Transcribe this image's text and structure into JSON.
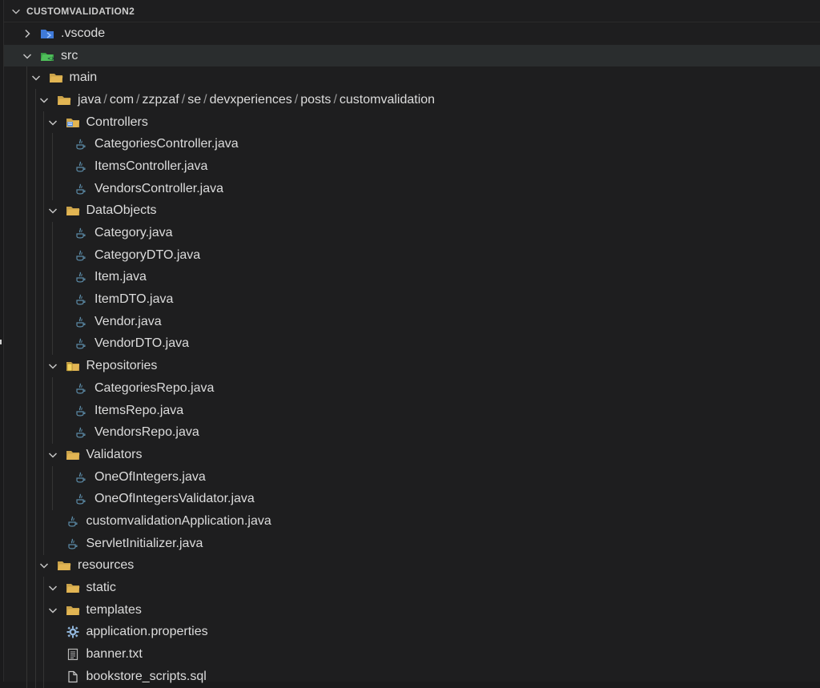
{
  "explorer": {
    "title": "CUSTOMVALIDATION2",
    "items": [
      {
        "label": ".vscode",
        "level": 1,
        "expanded": false,
        "icon": "vscode-folder-icon",
        "kind": "folder"
      },
      {
        "label": "src",
        "level": 1,
        "expanded": true,
        "icon": "src-folder-icon",
        "kind": "folder"
      },
      {
        "label": "main",
        "level": 2,
        "expanded": true,
        "icon": "folder-open-icon",
        "kind": "folder"
      },
      {
        "label": "java/com/zzpzaf/se/devxperiences/posts/customvalidation",
        "level": 3,
        "expanded": true,
        "icon": "folder-open-icon",
        "kind": "folder"
      },
      {
        "label": "Controllers",
        "level": 4,
        "expanded": true,
        "icon": "controllers-folder-icon",
        "kind": "folder"
      },
      {
        "label": "CategoriesController.java",
        "level": 5,
        "icon": "java-file-icon",
        "kind": "file"
      },
      {
        "label": "ItemsController.java",
        "level": 5,
        "icon": "java-file-icon",
        "kind": "file"
      },
      {
        "label": "VendorsController.java",
        "level": 5,
        "icon": "java-file-icon",
        "kind": "file"
      },
      {
        "label": "DataObjects",
        "level": 4,
        "expanded": true,
        "icon": "folder-open-icon",
        "kind": "folder"
      },
      {
        "label": "Category.java",
        "level": 5,
        "icon": "java-file-icon",
        "kind": "file"
      },
      {
        "label": "CategoryDTO.java",
        "level": 5,
        "icon": "java-file-icon",
        "kind": "file"
      },
      {
        "label": "Item.java",
        "level": 5,
        "icon": "java-file-icon",
        "kind": "file"
      },
      {
        "label": "ItemDTO.java",
        "level": 5,
        "icon": "java-file-icon",
        "kind": "file"
      },
      {
        "label": "Vendor.java",
        "level": 5,
        "icon": "java-file-icon",
        "kind": "file"
      },
      {
        "label": "VendorDTO.java",
        "level": 5,
        "icon": "java-file-icon",
        "kind": "file"
      },
      {
        "label": "Repositories",
        "level": 4,
        "expanded": true,
        "icon": "repositories-folder-icon",
        "kind": "folder"
      },
      {
        "label": "CategoriesRepo.java",
        "level": 5,
        "icon": "java-file-icon",
        "kind": "file"
      },
      {
        "label": "ItemsRepo.java",
        "level": 5,
        "icon": "java-file-icon",
        "kind": "file"
      },
      {
        "label": "VendorsRepo.java",
        "level": 5,
        "icon": "java-file-icon",
        "kind": "file"
      },
      {
        "label": "Validators",
        "level": 4,
        "expanded": true,
        "icon": "folder-open-icon",
        "kind": "folder"
      },
      {
        "label": "OneOfIntegers.java",
        "level": 5,
        "icon": "java-file-icon",
        "kind": "file"
      },
      {
        "label": "OneOfIntegersValidator.java",
        "level": 5,
        "icon": "java-file-icon",
        "kind": "file"
      },
      {
        "label": "customvalidationApplication.java",
        "level": 4,
        "icon": "java-file-icon",
        "kind": "file"
      },
      {
        "label": "ServletInitializer.java",
        "level": 4,
        "icon": "java-file-icon",
        "kind": "file"
      },
      {
        "label": "resources",
        "level": 3,
        "expanded": true,
        "icon": "folder-open-icon",
        "kind": "folder"
      },
      {
        "label": "static",
        "level": 4,
        "expanded": true,
        "icon": "folder-open-icon",
        "kind": "folder"
      },
      {
        "label": "templates",
        "level": 4,
        "expanded": true,
        "icon": "folder-open-icon",
        "kind": "folder"
      },
      {
        "label": "application.properties",
        "level": 4,
        "icon": "gear-icon",
        "kind": "file"
      },
      {
        "label": "banner.txt",
        "level": 4,
        "icon": "text-file-icon",
        "kind": "file"
      },
      {
        "label": "bookstore_scripts.sql",
        "level": 4,
        "icon": "file-icon",
        "kind": "file"
      }
    ]
  },
  "colors": {
    "folder": "#e2b553",
    "vscode_folder": "#3f7ad8",
    "src_folder": "#3a9b45",
    "java_icon": "#5b8aa6"
  }
}
